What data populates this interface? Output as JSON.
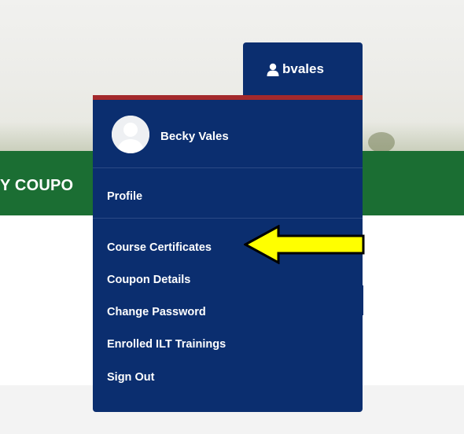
{
  "banner": {
    "text": "Y COUPO"
  },
  "user_menu": {
    "username": "bvales",
    "full_name": "Becky Vales",
    "items": [
      {
        "label": "Profile"
      },
      {
        "label": "Course Certificates"
      },
      {
        "label": "Coupon Details"
      },
      {
        "label": "Change Password"
      },
      {
        "label": "Enrolled ILT Trainings"
      },
      {
        "label": "Sign Out"
      }
    ]
  },
  "colors": {
    "navy": "#0b2e6f",
    "accent_red": "#a3292c",
    "green": "#1b6e33",
    "arrow_yellow": "#ffff00"
  },
  "icons": [
    "user-icon",
    "avatar-icon",
    "yellow-arrow-icon"
  ]
}
